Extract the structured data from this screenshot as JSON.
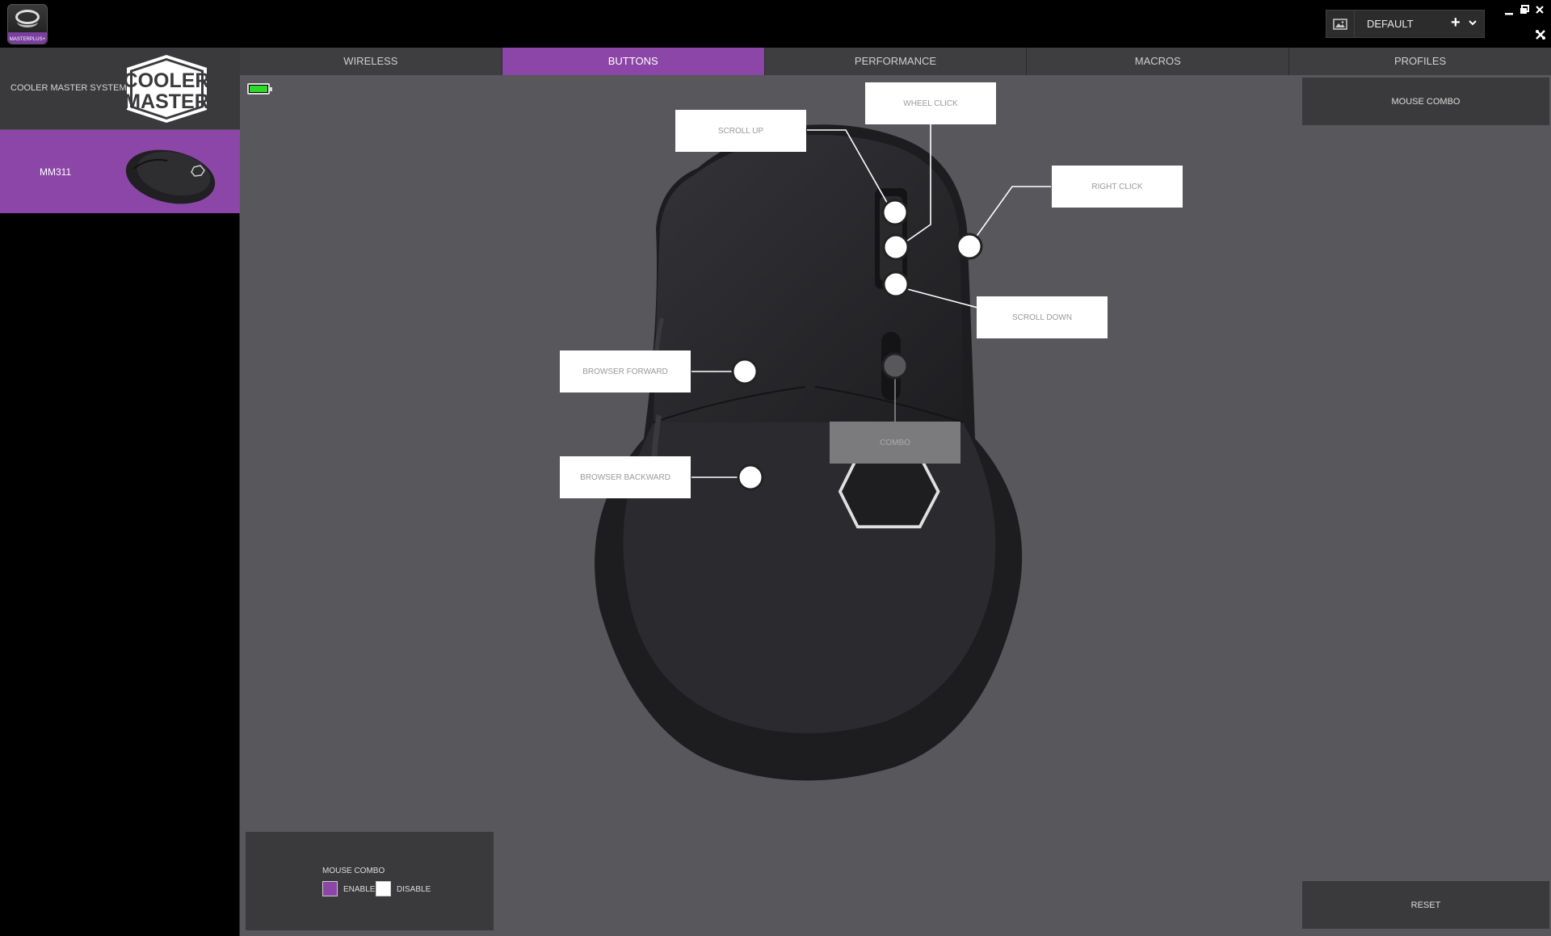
{
  "app": {
    "logo_text": "MASTERPLUS+"
  },
  "profile": {
    "name": "DEFAULT",
    "add": "+",
    "dropdown": "⌄"
  },
  "window_controls": {
    "minimize": "—",
    "restore": "❐",
    "close": "✕",
    "tools": "✖"
  },
  "sidebar": {
    "devices": [
      {
        "label": "COOLER MASTER SYSTEM",
        "logo_text_1": "COOLER",
        "logo_text_2": "MASTER"
      },
      {
        "label": "MM311"
      }
    ]
  },
  "tabs": [
    {
      "label": "WIRELESS"
    },
    {
      "label": "BUTTONS",
      "active": true
    },
    {
      "label": "PERFORMANCE"
    },
    {
      "label": "MACROS"
    },
    {
      "label": "PROFILES"
    }
  ],
  "buttons": {
    "scroll_up": "SCROLL UP",
    "wheel_click": "WHEEL CLICK",
    "right_click": "RIGHT CLICK",
    "scroll_down": "SCROLL DOWN",
    "browser_forward": "BROWSER FORWARD",
    "browser_backward": "BROWSER BACKWARD",
    "combo": "COMBO"
  },
  "right_panel": {
    "mouse_combo": "MOUSE COMBO",
    "reset": "RESET"
  },
  "combo_panel": {
    "title": "MOUSE COMBO",
    "enable": "ENABLE",
    "disable": "DISABLE",
    "enabled": true
  },
  "battery": {
    "level": 1.0,
    "color": "#2bd82b"
  },
  "colors": {
    "accent": "#8c46a8",
    "background": "#58585c"
  }
}
